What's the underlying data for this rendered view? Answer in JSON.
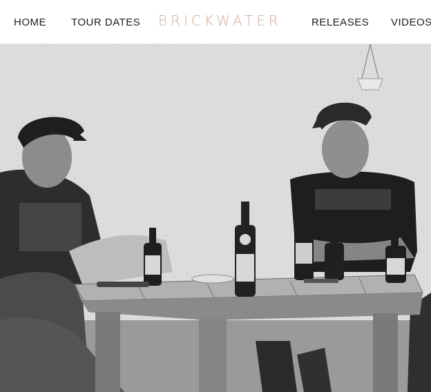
{
  "nav": {
    "items": [
      {
        "label": "HOME"
      },
      {
        "label": "TOUR DATES"
      },
      {
        "label": "RELEASES"
      },
      {
        "label": "VIDEOS"
      }
    ],
    "logo": "BRICKWATER"
  },
  "hero": {
    "slide_count": 3,
    "active_slide": 1
  },
  "colors": {
    "logo": "#d4a892",
    "nav_text": "#1b1b1b"
  }
}
